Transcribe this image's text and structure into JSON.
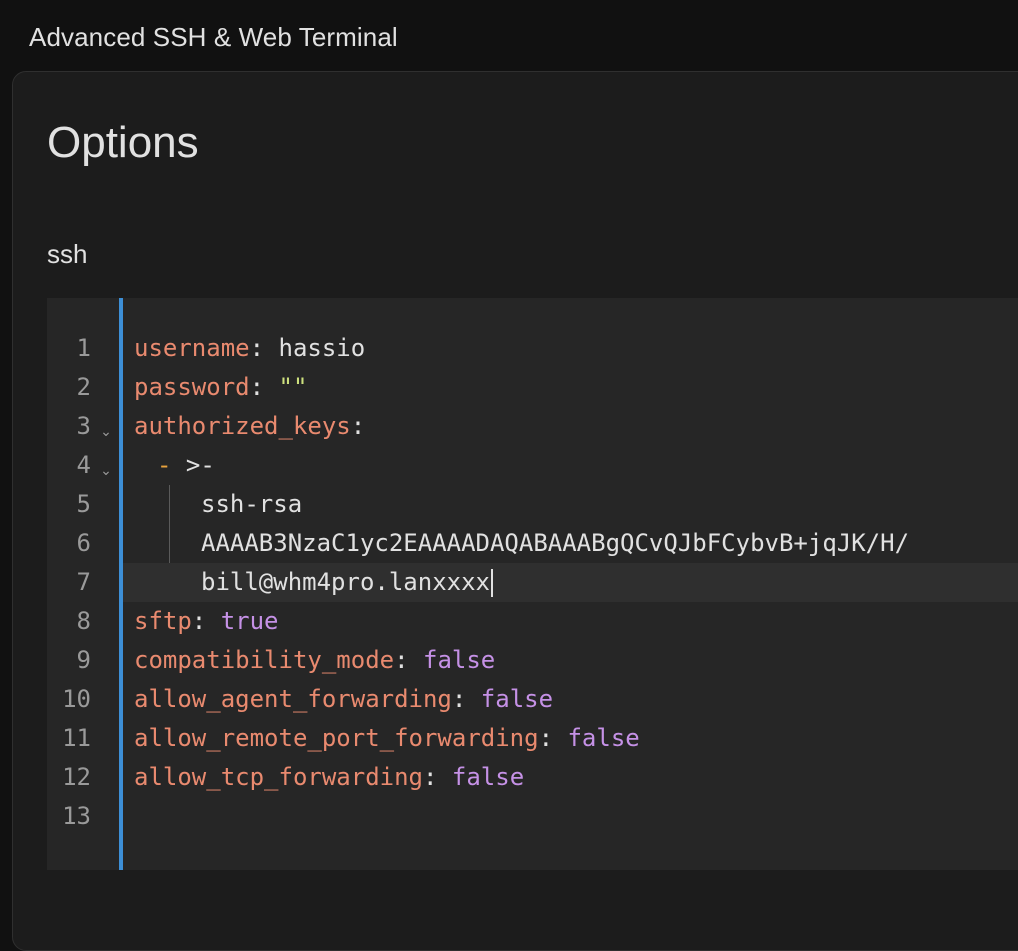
{
  "header": {
    "title": "Advanced SSH & Web Terminal"
  },
  "card": {
    "title": "Options",
    "section_label": "ssh"
  },
  "editor": {
    "line_numbers": [
      "1",
      "2",
      "3",
      "4",
      "5",
      "6",
      "7",
      "8",
      "9",
      "10",
      "11",
      "12",
      "13"
    ],
    "lines": {
      "l1": {
        "key": "username",
        "sep": ": ",
        "value": "hassio"
      },
      "l2": {
        "key": "password",
        "sep": ": ",
        "value": "\"\""
      },
      "l3": {
        "key": "authorized_keys",
        "sep": ":"
      },
      "l4": {
        "dash": "- ",
        "value": ">-"
      },
      "l5": {
        "value": "ssh-rsa"
      },
      "l6": {
        "value": "AAAAB3NzaC1yc2EAAAADAQABAAABgQCvQJbFCybvB+jqJK/H/"
      },
      "l7": {
        "value": "bill@whm4pro.lanxxxx"
      },
      "l8": {
        "key": "sftp",
        "sep": ": ",
        "value": "true"
      },
      "l9": {
        "key": "compatibility_mode",
        "sep": ": ",
        "value": "false"
      },
      "l10": {
        "key": "allow_agent_forwarding",
        "sep": ": ",
        "value": "false"
      },
      "l11": {
        "key": "allow_remote_port_forwarding",
        "sep": ": ",
        "value": "false"
      },
      "l12": {
        "key": "allow_tcp_forwarding",
        "sep": ": ",
        "value": "false"
      }
    },
    "fold_icon": "chevron-down-icon"
  },
  "colors": {
    "key": "#e98a6f",
    "string": "#cde07e",
    "boolean": "#c591e6",
    "focus_bar": "#3d8fd6",
    "background": "#1c1c1c"
  }
}
